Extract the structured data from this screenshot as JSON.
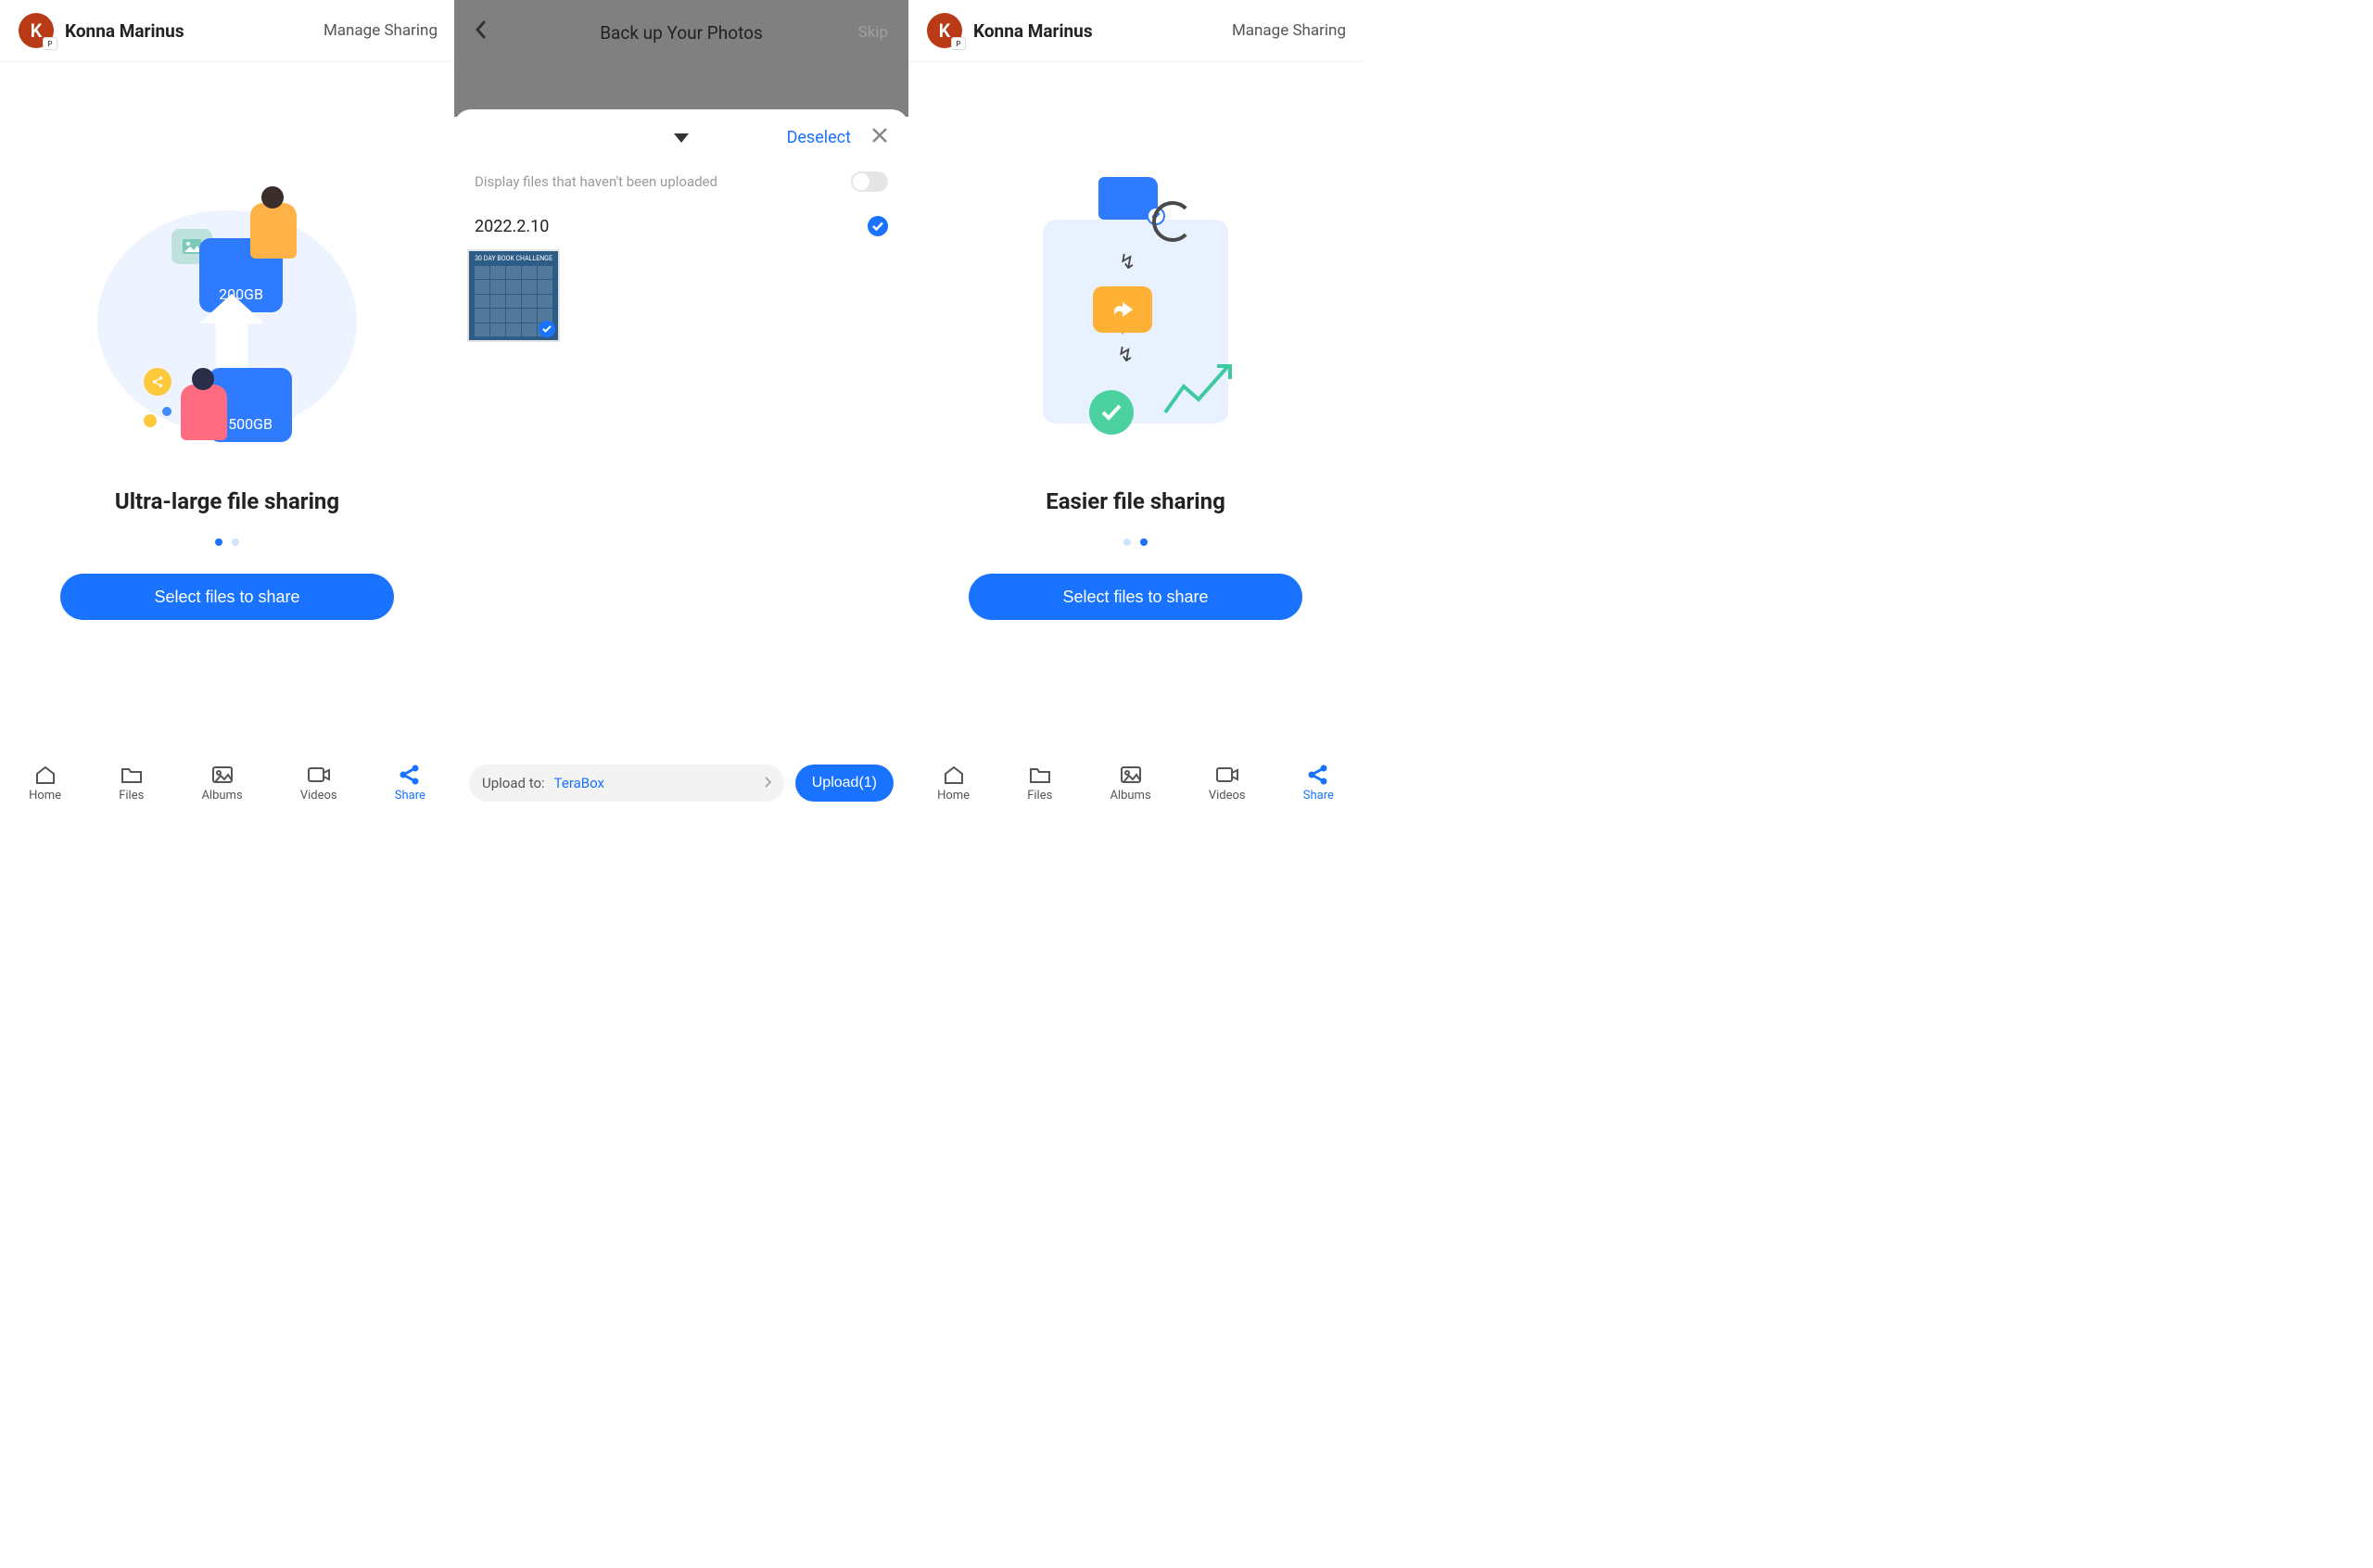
{
  "user": {
    "initial": "K",
    "badge": "P",
    "name": "Konna Marinus"
  },
  "share": {
    "manage": "Manage Sharing",
    "title_left": "Ultra-large file sharing",
    "title_right": "Easier file sharing",
    "select_btn": "Select files to share",
    "card_200": "200GB",
    "card_500": "500GB"
  },
  "tabs": {
    "home": "Home",
    "files": "Files",
    "albums": "Albums",
    "videos": "Videos",
    "share": "Share"
  },
  "backup": {
    "title": "Back up Your Photos",
    "skip": "Skip",
    "deselect": "Deselect",
    "filter_text": "Display files that haven't been uploaded",
    "date": "2022.2.10",
    "thumb_caption": "30 DAY BOOK CHALLENGE",
    "upload_to_label": "Upload to:",
    "upload_dest": "TeraBox",
    "upload_btn": "Upload(1)"
  }
}
